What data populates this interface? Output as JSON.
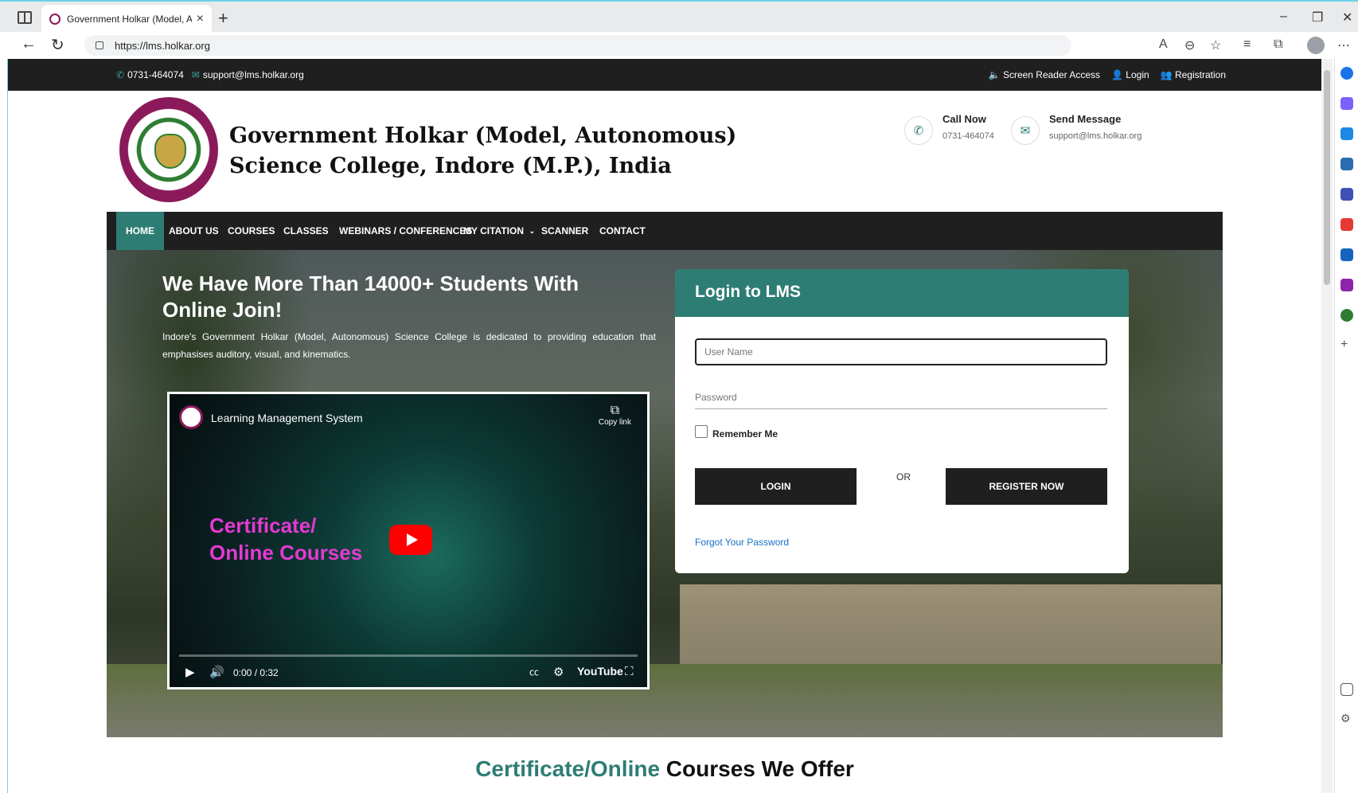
{
  "browser": {
    "tab_title": "Government Holkar (Model, Auto",
    "url": "https://lms.holkar.org"
  },
  "topbar": {
    "phone": "0731-464074",
    "email": "support@lms.holkar.org",
    "screen_reader": "Screen Reader Access",
    "login": "Login",
    "registration": "Registration"
  },
  "header": {
    "college_line1": "Government Holkar (Model, Autonomous)",
    "college_line2": "Science College, Indore (M.P.), India",
    "call_title": "Call Now",
    "call_value": "0731-464074",
    "msg_title": "Send Message",
    "msg_value": "support@lms.holkar.org"
  },
  "nav": {
    "items": [
      "HOME",
      "ABOUT US",
      "COURSES",
      "CLASSES",
      "WEBINARS / CONFERENCES",
      "MY CITATION",
      "SCANNER",
      "CONTACT"
    ],
    "active": "HOME"
  },
  "hero": {
    "title": "We Have More Than 14000+ Students With Online Join!",
    "description": "Indore's Government Holkar (Model, Autonomous) Science College is dedicated to providing education that emphasises auditory, visual, and kinematics."
  },
  "video": {
    "title": "Learning Management System",
    "copy_link": "Copy link",
    "overlay_line1": "Certificate/",
    "overlay_line2": "Online Courses",
    "time": "0:00 / 0:32",
    "brand": "YouTube"
  },
  "login": {
    "heading": "Login to LMS",
    "username_placeholder": "User Name",
    "password_placeholder": "Password",
    "remember": "Remember Me",
    "login_btn": "LOGIN",
    "or": "OR",
    "register_btn": "REGISTER NOW",
    "forgot": "Forgot Your Password"
  },
  "section": {
    "accent": "Certificate/Online",
    "rest": " Courses We Offer"
  },
  "colors": {
    "accent": "#2e7d74",
    "dark": "#1f1f1f"
  }
}
